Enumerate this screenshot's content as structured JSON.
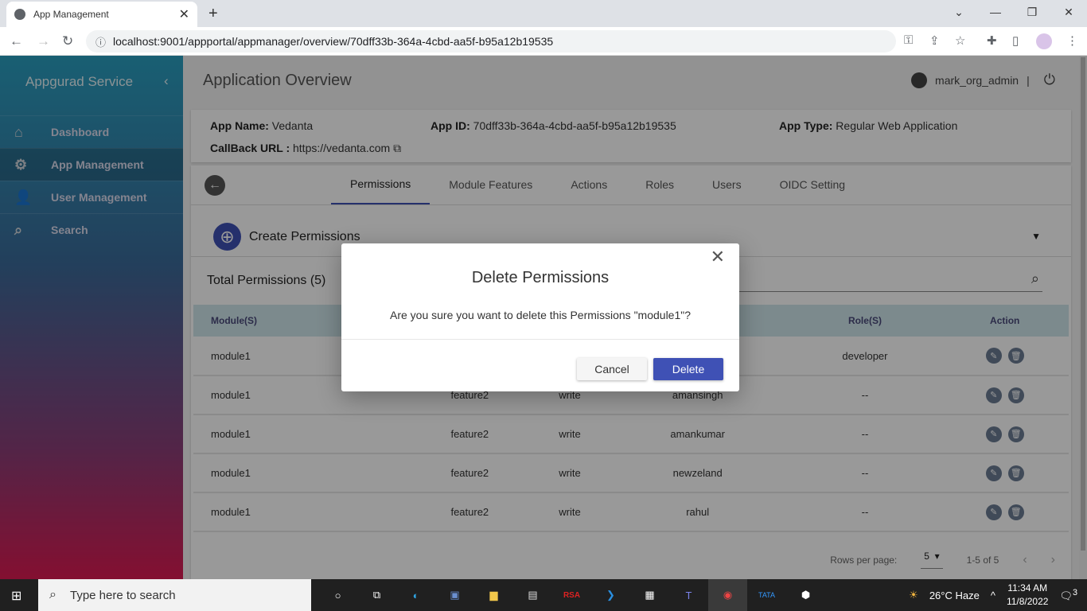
{
  "browser": {
    "tab_title": "App Management",
    "url": "localhost:9001/appportal/appmanager/overview/70dff33b-364a-4cbd-aa5f-b95a12b19535"
  },
  "sidebar": {
    "brand": "Appgurad Service",
    "items": [
      {
        "label": "Dashboard",
        "icon": "home-icon"
      },
      {
        "label": "App Management",
        "icon": "app-settings-icon",
        "active": true
      },
      {
        "label": "User Management",
        "icon": "user-settings-icon"
      },
      {
        "label": "Search",
        "icon": "search-icon"
      }
    ]
  },
  "header": {
    "title": "Application Overview",
    "username": "mark_org_admin",
    "separator": "|"
  },
  "app_info": {
    "name_label": "App Name:",
    "name": "Vedanta",
    "id_label": "App ID:",
    "id": "70dff33b-364a-4cbd-aa5f-b95a12b19535",
    "type_label": "App Type:",
    "type": "Regular Web Application",
    "callback_label": "CallBack URL :",
    "callback": "https://vedanta.com"
  },
  "tabs": [
    "Permissions",
    "Module Features",
    "Actions",
    "Roles",
    "Users",
    "OIDC Setting"
  ],
  "create_label": "Create Permissions",
  "total_label": "Total Permissions (5)",
  "table": {
    "headers": [
      "Module(S)",
      "",
      "",
      "User(S)",
      "Role(S)",
      "Action"
    ],
    "rows": [
      [
        "module1",
        "",
        "",
        "--",
        "developer"
      ],
      [
        "module1",
        "feature2",
        "write",
        "amansingh",
        "--"
      ],
      [
        "module1",
        "feature2",
        "write",
        "amankumar",
        "--"
      ],
      [
        "module1",
        "feature2",
        "write",
        "newzeland",
        "--"
      ],
      [
        "module1",
        "feature2",
        "write",
        "rahul",
        "--"
      ]
    ]
  },
  "pagination": {
    "rows_per_page_label": "Rows per page:",
    "rows_per_page": "5",
    "range": "1-5 of 5"
  },
  "dialog": {
    "title": "Delete Permissions",
    "message": "Are you sure you want to delete this Permissions \"module1\"?",
    "cancel": "Cancel",
    "delete": "Delete"
  },
  "taskbar": {
    "search_placeholder": "Type here to search",
    "weather": "26°C  Haze",
    "time": "11:34 AM",
    "date": "11/8/2022",
    "notifications": "3"
  },
  "colors": {
    "accent": "#3f51b5",
    "table_header": "#cfe6ec"
  }
}
